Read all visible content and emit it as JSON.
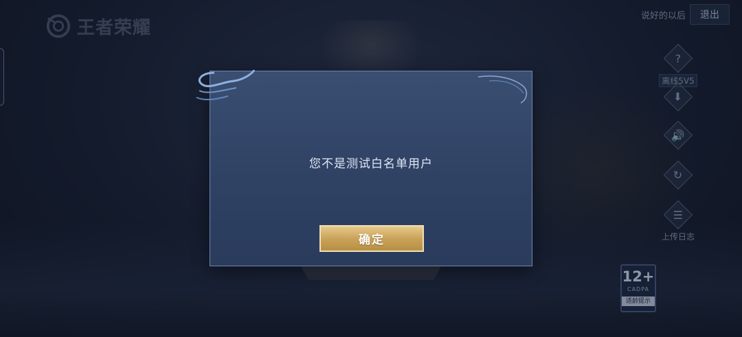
{
  "app": {
    "logo_text": "王者荣耀"
  },
  "top_right": {
    "prompt": "说好的以后",
    "exit_label": "退出"
  },
  "side_menu": {
    "items": [
      {
        "icon": "question-icon",
        "glyph": "?",
        "label": "离线5V5",
        "boxed": true
      },
      {
        "icon": "download-icon",
        "glyph": "⬇",
        "label": ""
      },
      {
        "icon": "speaker-icon",
        "glyph": "🔊",
        "label": ""
      },
      {
        "icon": "phone-rotate-icon",
        "glyph": "↻",
        "label": ""
      },
      {
        "icon": "document-icon",
        "glyph": "☰",
        "label": "上传日志"
      }
    ]
  },
  "dialog": {
    "message": "您不是测试白名单用户",
    "confirm_label": "确定"
  },
  "age_badge": {
    "age": "12+",
    "org": "CADPA",
    "tip": "适龄提示"
  },
  "colors": {
    "accent_gold": "#c9a35a",
    "dialog_bg": "#34476a",
    "dialog_border": "#6f86ad"
  }
}
